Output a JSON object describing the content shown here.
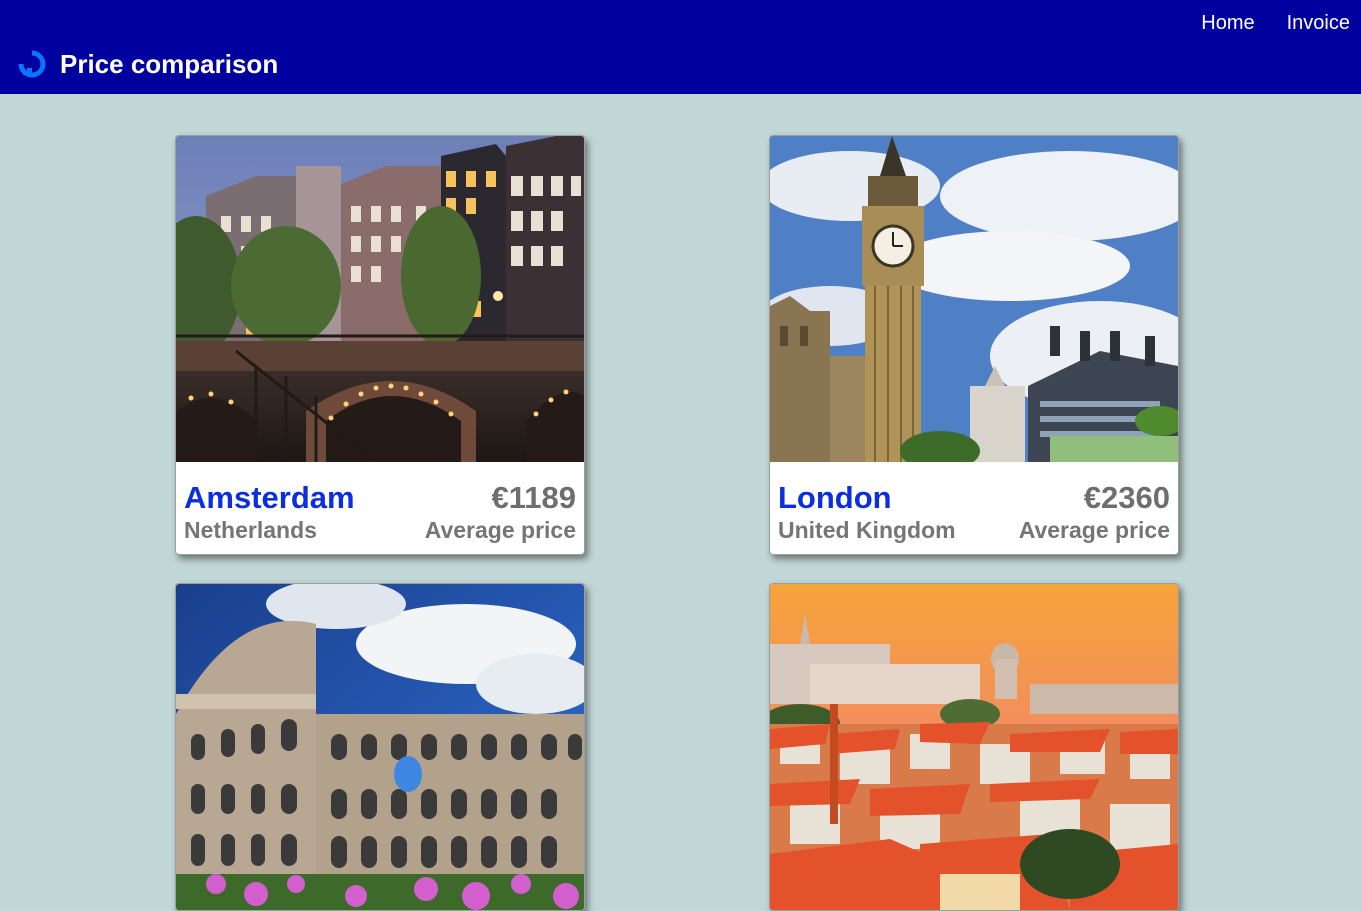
{
  "header": {
    "title": "Price comparison",
    "logo_icon": "refresh-ring-logo-icon",
    "background_color": "#00009e",
    "nav": {
      "home_label": "Home",
      "invoice_label": "Invoice"
    }
  },
  "cards": [
    {
      "city": "Amsterdam",
      "country": "Netherlands",
      "price": "€1189",
      "price_label": "Average price",
      "image_subject": "canal-bridge-photo"
    },
    {
      "city": "London",
      "country": "United Kingdom",
      "price": "€2360",
      "price_label": "Average price",
      "image_subject": "big-ben-photo"
    },
    {
      "image_subject": "colosseum-photo"
    },
    {
      "image_subject": "lisbon-rooftops-photo"
    }
  ],
  "colors": {
    "page_background": "#c1d7d5",
    "city_text": "#0b2fe0",
    "secondary_text": "#757575"
  }
}
